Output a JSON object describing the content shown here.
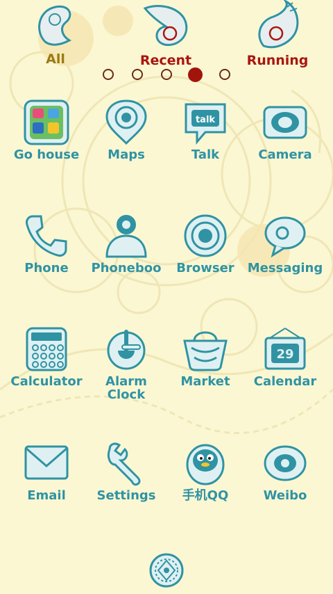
{
  "colors": {
    "background": "#fbf7d3",
    "teal": "#2f93a3",
    "tab_all": "#9a7a14",
    "tab_active": "#a8170f",
    "dot_active": "#a0140c"
  },
  "tabs": [
    {
      "label": "All",
      "icon": "paisley-icon"
    },
    {
      "label": "Recent",
      "icon": "paisley-icon"
    },
    {
      "label": "Running",
      "icon": "paisley-icon"
    }
  ],
  "pager": {
    "count": 5,
    "active_index": 4
  },
  "apps": [
    {
      "label": "Go house",
      "icon": "go-house-icon"
    },
    {
      "label": "Maps",
      "icon": "map-pin-icon"
    },
    {
      "label": "Talk",
      "icon": "talk-icon"
    },
    {
      "label": "Camera",
      "icon": "camera-icon"
    },
    {
      "label": "Phone",
      "icon": "phone-icon"
    },
    {
      "label": "Phoneboo",
      "icon": "contacts-icon"
    },
    {
      "label": "Browser",
      "icon": "globe-icon"
    },
    {
      "label": "Messaging",
      "icon": "message-icon"
    },
    {
      "label": "Calculator",
      "icon": "calculator-icon"
    },
    {
      "label": "Alarm Clock",
      "icon": "alarm-clock-icon"
    },
    {
      "label": "Market",
      "icon": "basket-icon"
    },
    {
      "label": "Calendar",
      "icon": "calendar-icon"
    },
    {
      "label": "Email",
      "icon": "envelope-icon"
    },
    {
      "label": "Settings",
      "icon": "wrench-icon"
    },
    {
      "label": "手机QQ",
      "icon": "penguin-icon"
    },
    {
      "label": "Weibo",
      "icon": "weibo-eye-icon"
    }
  ],
  "calendar_day": "29",
  "talk_badge": "talk",
  "dock": {
    "icon": "app-drawer-icon"
  }
}
